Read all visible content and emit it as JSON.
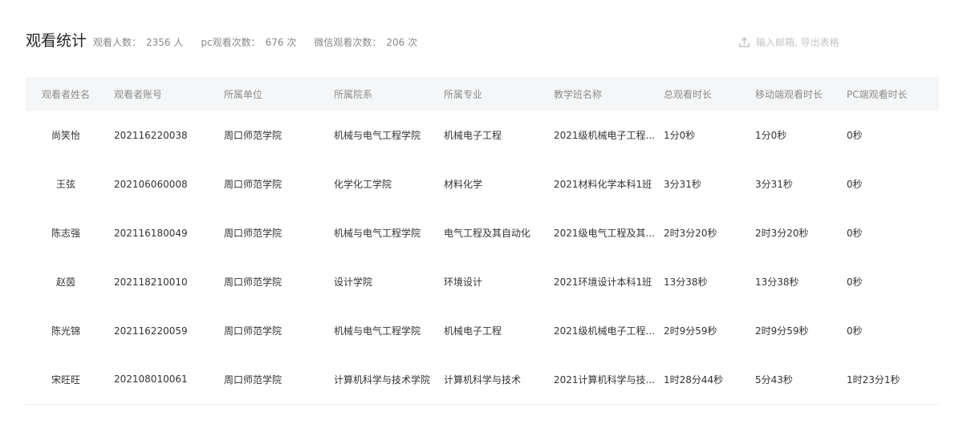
{
  "header": {
    "title": "观看统计",
    "viewers_label": "观看人数：",
    "viewers_value": "2356 人",
    "pc_label": "pc观看次数：",
    "pc_value": "676 次",
    "wechat_label": "微信观看次数：",
    "wechat_value": "206 次",
    "export_icon": "upload-icon",
    "export_text": "输入邮箱, 导出表格"
  },
  "colors": {
    "header_bg": "#f5f6f7",
    "muted_text": "#888888",
    "body_text": "#333333"
  },
  "table": {
    "columns": [
      "观看者姓名",
      "观看者账号",
      "所属单位",
      "所属院系",
      "所属专业",
      "教学班名称",
      "总观看时长",
      "移动端观看时长",
      "PC端观看时长"
    ],
    "rows": [
      {
        "name": "尚笑怡",
        "account": "202116220038",
        "unit": "周口师范学院",
        "dept": "机械与电气工程学院",
        "major": "机械电子工程",
        "class": "2021级机械电子工程...",
        "total": "1分0秒",
        "mobile": "1分0秒",
        "pc": "0秒"
      },
      {
        "name": "王弦",
        "account": "202106060008",
        "unit": "周口师范学院",
        "dept": "化学化工学院",
        "major": "材料化学",
        "class": "2021材料化学本科1班",
        "total": "3分31秒",
        "mobile": "3分31秒",
        "pc": "0秒"
      },
      {
        "name": "陈志强",
        "account": "202116180049",
        "unit": "周口师范学院",
        "dept": "机械与电气工程学院",
        "major": "电气工程及其自动化",
        "class": "2021级电气工程及其...",
        "total": "2时3分20秒",
        "mobile": "2时3分20秒",
        "pc": "0秒"
      },
      {
        "name": "赵茵",
        "account": "202118210010",
        "unit": "周口师范学院",
        "dept": "设计学院",
        "major": "环境设计",
        "class": "2021环境设计本科1班",
        "total": "13分38秒",
        "mobile": "13分38秒",
        "pc": "0秒"
      },
      {
        "name": "陈光锦",
        "account": "202116220059",
        "unit": "周口师范学院",
        "dept": "机械与电气工程学院",
        "major": "机械电子工程",
        "class": "2021级机械电子工程...",
        "total": "2时9分59秒",
        "mobile": "2时9分59秒",
        "pc": "0秒"
      },
      {
        "name": "宋旺旺",
        "account": "202108010061",
        "unit": "周口师范学院",
        "dept": "计算机科学与技术学院",
        "major": "计算机科学与技术",
        "class": "2021计算机科学与技...",
        "total": "1时28分44秒",
        "mobile": "5分43秒",
        "pc": "1时23分1秒"
      }
    ]
  }
}
